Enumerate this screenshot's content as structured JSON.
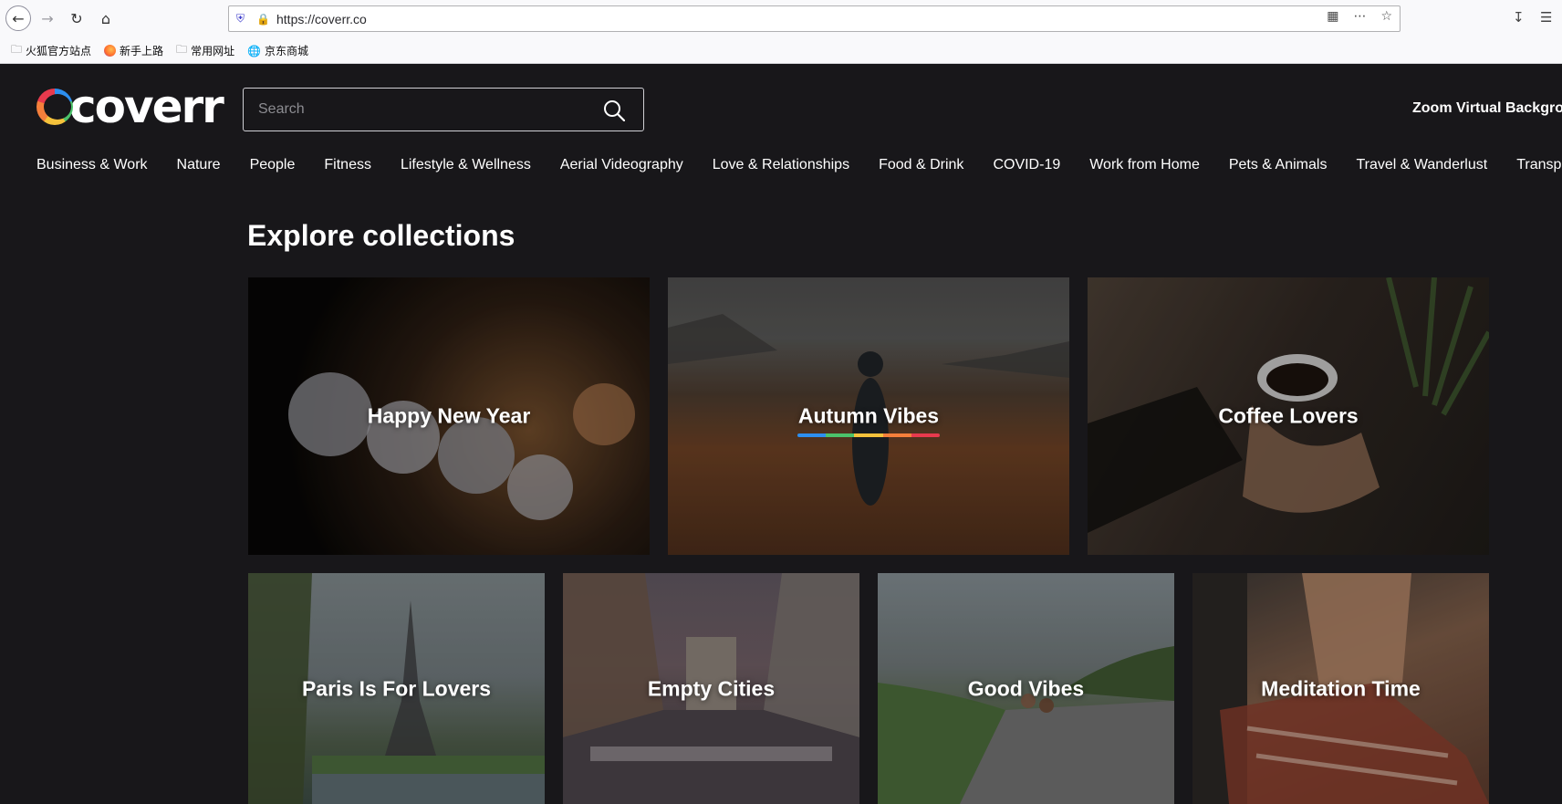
{
  "browser": {
    "url": "https://coverr.co",
    "bookmarks": [
      {
        "label": "火狐官方站点",
        "icon": "folder-icon"
      },
      {
        "label": "新手上路",
        "icon": "firefox-icon"
      },
      {
        "label": "常用网址",
        "icon": "folder-icon"
      },
      {
        "label": "京东商城",
        "icon": "globe-icon"
      }
    ]
  },
  "header": {
    "logo_text": "coverr",
    "search_placeholder": "Search",
    "zoom_link": "Zoom Virtual Backgrou"
  },
  "categories": [
    "Business & Work",
    "Nature",
    "People",
    "Fitness",
    "Lifestyle & Wellness",
    "Aerial Videography",
    "Love & Relationships",
    "Food & Drink",
    "COVID-19",
    "Work from Home",
    "Pets & Animals",
    "Travel & Wanderlust",
    "Transp"
  ],
  "collections": {
    "title": "Explore collections",
    "items": [
      {
        "label": "Happy New Year"
      },
      {
        "label": "Autumn Vibes",
        "hovered": true
      },
      {
        "label": "Coffee Lovers"
      },
      {
        "label": "Paris Is For Lovers"
      },
      {
        "label": "Empty Cities"
      },
      {
        "label": "Good Vibes"
      },
      {
        "label": "Meditation Time"
      }
    ],
    "underline_colors": [
      "#2d8ff0",
      "#4bc26a",
      "#f5c23b",
      "#f57f3b",
      "#e83a4d"
    ]
  }
}
